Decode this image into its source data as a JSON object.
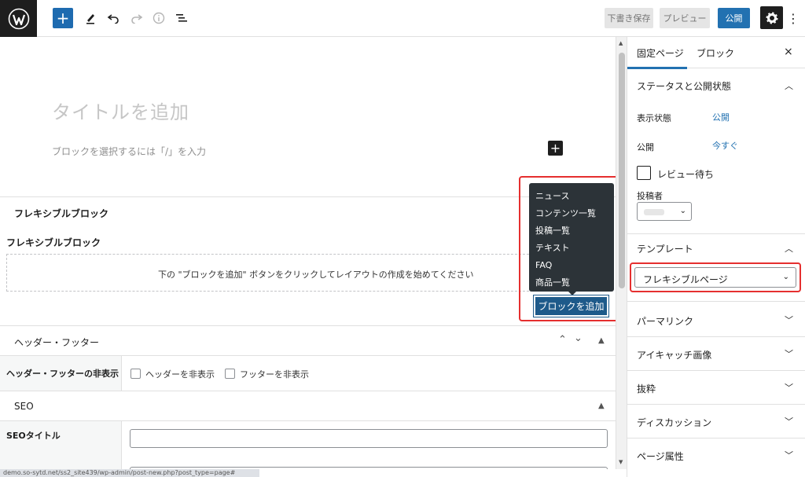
{
  "toolbar": {
    "draft_label": "下書き保存",
    "preview_label": "プレビュー",
    "publish_label": "公開",
    "add_label": "+",
    "more_label": "⋮"
  },
  "editor": {
    "title_placeholder": "タイトルを追加",
    "block_placeholder": "ブロックを選択するには「/」を入力",
    "flexible_header": "フレキシブルブロック",
    "flexible_sub": "フレキシブルブロック",
    "empty_message": "下の \"ブロックを追加\" ボタンをクリックしてレイアウトの作成を始めてください",
    "add_block_label": "ブロックを追加",
    "dropdown_items": [
      "ニュース",
      "コンテンツ一覧",
      "投稿一覧",
      "テキスト",
      "FAQ",
      "商品一覧"
    ],
    "header_footer_title": "ヘッダー・フッター",
    "header_footer_hide_label": "ヘッダー・フッターの非表示",
    "hide_header_label": "ヘッダーを非表示",
    "hide_footer_label": "フッターを非表示",
    "seo_title": "SEO",
    "seo_title_label": "SEOタイトル"
  },
  "sidebar": {
    "tab_page": "固定ページ",
    "tab_block": "ブロック",
    "close_label": "×",
    "status_section": "ステータスと公開状態",
    "visibility_label": "表示状態",
    "visibility_value": "公開",
    "publish_label": "公開",
    "publish_value": "今すぐ",
    "pending_label": "レビュー待ち",
    "author_label": "投稿者",
    "template_section": "テンプレート",
    "template_value": "フレキシブルページ",
    "sections": [
      "パーマリンク",
      "アイキャッチ画像",
      "抜粋",
      "ディスカッション",
      "ページ属性"
    ]
  },
  "statusbar": {
    "url": "demo.so-sytd.net/ss2_site439/wp-admin/post-new.php?post_type=page#"
  },
  "colors": {
    "accent": "#2271b1",
    "highlight": "#e52f2f",
    "dark": "#1e1e1e"
  }
}
